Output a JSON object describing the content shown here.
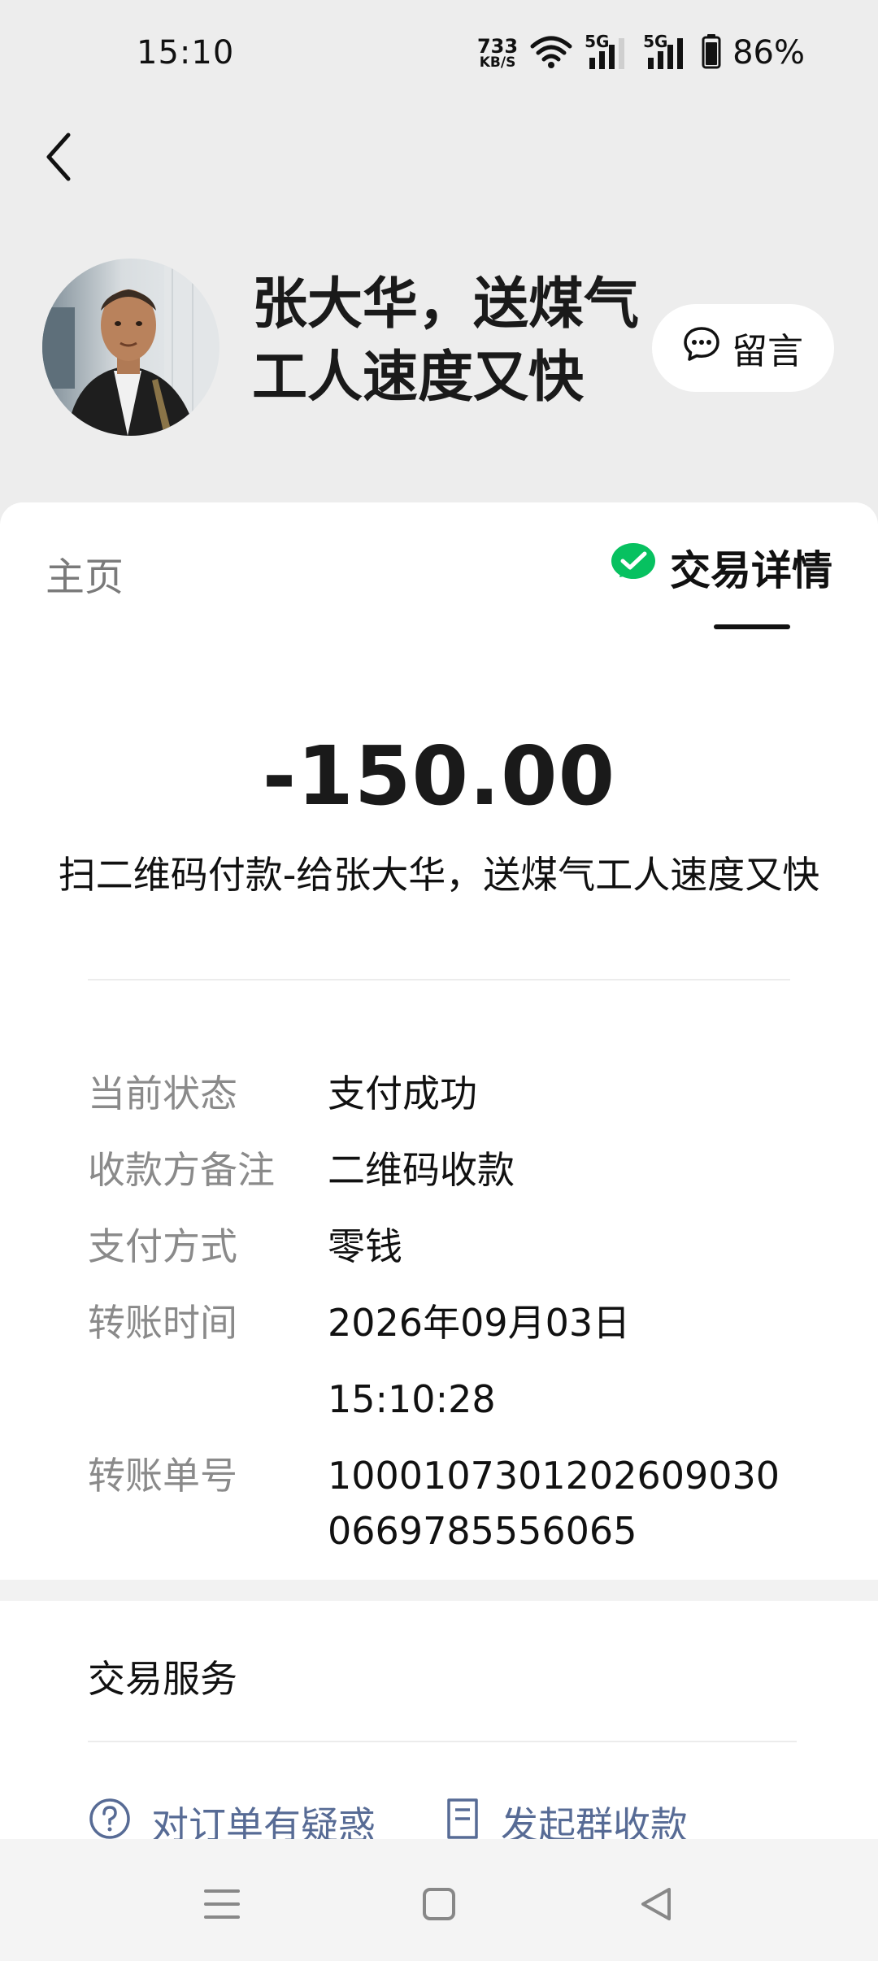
{
  "status_bar": {
    "time": "15:10",
    "net_speed_value": "733",
    "net_speed_unit": "KB/S",
    "signal_1_label": "5G",
    "signal_2_label": "5G",
    "battery": "86%"
  },
  "header": {
    "name_line1": "张大华，送煤气",
    "name_line2": "工人速度又快",
    "message_label": "留言"
  },
  "tabs": {
    "home_label": "主页",
    "detail_label": "交易详情"
  },
  "transaction": {
    "amount": "-150.00",
    "description": "扫二维码付款-给张大华，送煤气工人速度又快",
    "details": [
      {
        "label": "当前状态",
        "value": "支付成功"
      },
      {
        "label": "收款方备注",
        "value": "二维码收款"
      },
      {
        "label": "支付方式",
        "value": "零钱"
      },
      {
        "label": "转账时间",
        "value": "2026年09月03日 15:10:28"
      },
      {
        "label": "转账单号",
        "value": "100010730120260903006​69785556065"
      }
    ]
  },
  "services": {
    "title": "交易服务",
    "question_label": "对订单有疑惑",
    "group_collect_label": "发起群收款"
  },
  "colors": {
    "wechat_green": "#07c160",
    "link_blue": "#576b95",
    "background": "#ededed"
  },
  "icons": {
    "back": "chevron-left-icon",
    "message": "chat-bubble-icon",
    "wechat_pay": "wechat-pay-icon",
    "question": "question-circle-icon",
    "group_collect": "document-icon"
  }
}
